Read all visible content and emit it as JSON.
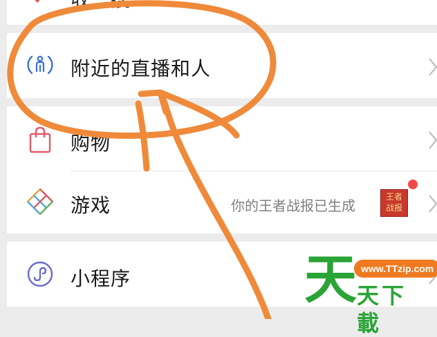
{
  "menu": {
    "partial_top_label": "收一搜",
    "nearby": {
      "label": "附近的直播和人",
      "icon": "person-broadcast-icon"
    },
    "shopping": {
      "label": "购物",
      "icon": "shopping-bag-icon"
    },
    "games": {
      "label": "游戏",
      "icon": "game-diamond-icon",
      "subtext": "你的王者战报已生成",
      "badge_line1": "王者",
      "badge_line2": "战报"
    },
    "miniprogram": {
      "label": "小程序",
      "icon": "mini-program-icon"
    }
  },
  "watermark": {
    "url": "www.TTzip.com",
    "big_char": "天",
    "text": "天下載"
  },
  "colors": {
    "annotation": "#ef8a3a",
    "watermark_green": "#2aa436",
    "watermark_orange": "#f07a1f"
  }
}
